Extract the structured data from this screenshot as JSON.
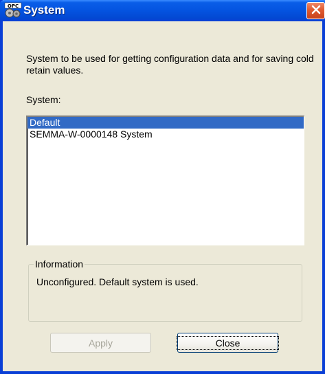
{
  "window": {
    "title": "System",
    "icon": "opc-app-icon",
    "close_icon": "close-x-icon"
  },
  "description": "System to be used for getting configuration data and for saving cold retain values.",
  "system_label": "System:",
  "systems": [
    {
      "label": "Default",
      "selected": true
    },
    {
      "label": "SEMMA-W-0000148 System",
      "selected": false
    }
  ],
  "information": {
    "legend": "Information",
    "text": "Unconfigured. Default system is used."
  },
  "buttons": {
    "apply_label": "Apply",
    "apply_enabled": false,
    "close_label": "Close"
  },
  "colors": {
    "title_bar": "#0453e0",
    "selection": "#316ac5",
    "dialog_bg": "#ece9d8",
    "close_button": "#e05a30"
  }
}
